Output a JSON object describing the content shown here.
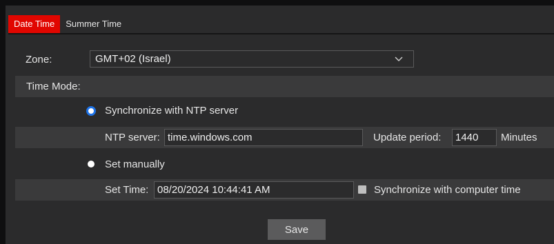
{
  "tabs": [
    {
      "label": "Date Time",
      "active": true
    },
    {
      "label": "Summer Time",
      "active": false
    }
  ],
  "zone": {
    "label": "Zone:",
    "selected": "GMT+02 (Israel)"
  },
  "time_mode": {
    "label": "Time Mode:"
  },
  "ntp": {
    "option_label": "Synchronize with NTP server",
    "checked": true,
    "server_label": "NTP server:",
    "server_value": "time.windows.com",
    "update_label": "Update period:",
    "update_value": "1440",
    "update_unit": "Minutes"
  },
  "manual": {
    "option_label": "Set manually",
    "checked": false,
    "set_time_label": "Set Time:",
    "set_time_value": "08/20/2024 10:44:41 AM",
    "sync_computer_label": "Synchronize with computer time"
  },
  "save_label": "Save",
  "colors": {
    "accent": "#e10600",
    "radio": "#1e73e8"
  }
}
